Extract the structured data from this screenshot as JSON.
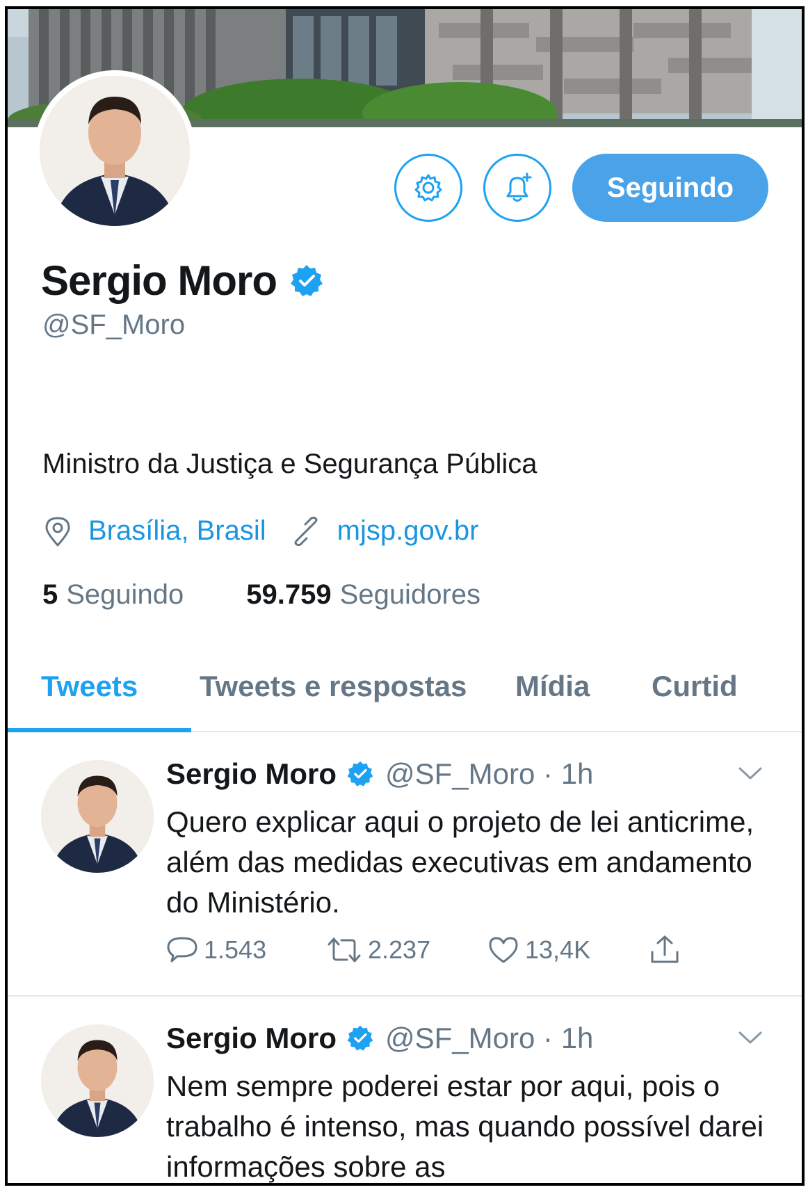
{
  "profile": {
    "name": "Sergio Moro",
    "handle": "@SF_Moro",
    "bio": "Ministro da Justiça e Segurança Pública",
    "location": "Brasília, Brasil",
    "website": "mjsp.gov.br",
    "following_count": "5",
    "following_label": "Seguindo",
    "followers_count": "59.759",
    "followers_label": "Seguidores",
    "follow_button_label": "Seguindo"
  },
  "tabs": [
    {
      "label": "Tweets",
      "active": true
    },
    {
      "label": "Tweets e respostas",
      "active": false
    },
    {
      "label": "Mídia",
      "active": false
    },
    {
      "label": "Curtid",
      "active": false
    }
  ],
  "tweets": [
    {
      "name": "Sergio Moro",
      "handle_time": "@SF_Moro · 1h",
      "text": "Quero explicar aqui o projeto de lei anticrime, além das medidas executivas em andamento do Ministério.",
      "replies": "1.543",
      "retweets": "2.237",
      "likes": "13,4K"
    },
    {
      "name": "Sergio Moro",
      "handle_time": "@SF_Moro · 1h",
      "text": "Nem sempre poderei estar por aqui, pois o trabalho é intenso, mas quando possível darei informações sobre as"
    }
  ],
  "colors": {
    "accent": "#1da1f2",
    "button_fill": "#4aa3e8",
    "secondary_text": "#657786",
    "primary_text": "#14171a"
  },
  "icons": [
    "gear-icon",
    "bell-plus-icon",
    "verified-badge-icon",
    "location-pin-icon",
    "link-icon",
    "reply-icon",
    "retweet-icon",
    "heart-icon",
    "share-icon",
    "chevron-down-icon"
  ]
}
